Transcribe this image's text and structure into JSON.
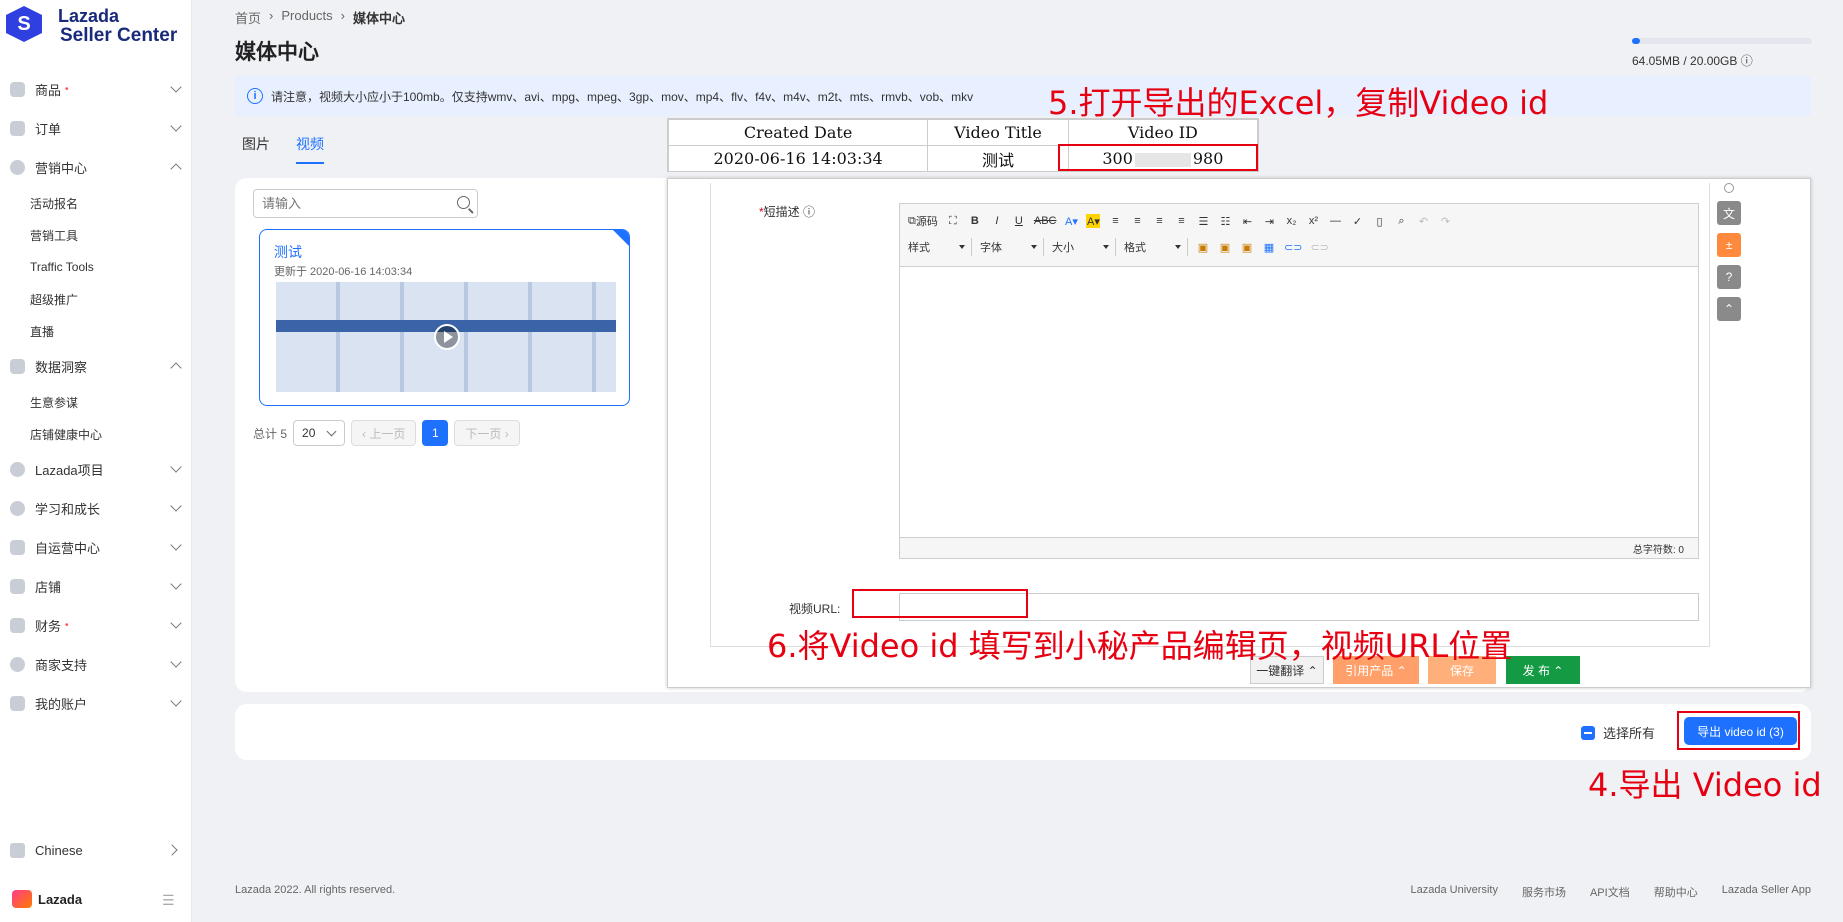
{
  "brand": {
    "line1": "Lazada",
    "line2": "Seller Center",
    "mark": "S"
  },
  "sidebar": {
    "items": [
      {
        "label": "商品",
        "dot": "•"
      },
      {
        "label": "订单"
      },
      {
        "label": "营销中心",
        "sub": [
          "活动报名",
          "营销工具",
          "Traffic Tools",
          "超级推广",
          "直播"
        ]
      },
      {
        "label": "数据洞察",
        "sub": [
          "生意参谋",
          "店铺健康中心"
        ]
      },
      {
        "label": "Lazada项目"
      },
      {
        "label": "学习和成长"
      },
      {
        "label": "自运营中心"
      },
      {
        "label": "店铺"
      },
      {
        "label": "财务",
        "dot": "•"
      },
      {
        "label": "商家支持"
      },
      {
        "label": "我的账户"
      }
    ],
    "language": "Chinese",
    "footer_logo": "Lazada"
  },
  "breadcrumb": [
    "首页",
    "Products",
    "媒体中心"
  ],
  "breadcrumb_sep": "›",
  "page_title": "媒体中心",
  "storage": {
    "text": "64.05MB / 20.00GB",
    "used_fraction": 0.003
  },
  "notice": "请注意，视频大小应小于100mb。仅支持wmv、avi、mpg、mpeg、3gp、mov、mp4、flv、f4v、m4v、m2t、mts、rmvb、vob、mkv",
  "tabs": [
    "图片",
    "视频"
  ],
  "search": {
    "placeholder": "请输入"
  },
  "video": {
    "title": "测试",
    "updated": "更新于 2020-06-16 14:03:34"
  },
  "pager": {
    "total": "总计 5",
    "size": "20",
    "prev": "‹ 上一页",
    "current": "1",
    "next": "下一页 ›"
  },
  "excel": {
    "headers": [
      "Created Date",
      "Video Title",
      "Video ID"
    ],
    "row": [
      "2020-06-16 14:03:34",
      "测试",
      "300",
      "980"
    ]
  },
  "editor": {
    "desc_label": "短描述",
    "required_mark": "*",
    "toolbar": {
      "source": "源码",
      "style": "样式",
      "font": "字体",
      "size": "大小",
      "format": "格式"
    },
    "char_count": "总字符数: 0",
    "url_label": "视频URL:",
    "buttons": {
      "translate": "一键翻译 ⌃",
      "quote": "引用产品 ⌃",
      "save": "保存",
      "publish": "发 布 ⌃"
    }
  },
  "bottom": {
    "select_all": "选择所有",
    "export": "导出 video id (3)"
  },
  "annotations": {
    "step5": "5.打开导出的Excel，复制Video id",
    "step6": "6.将Video id 填写到小秘产品编辑页，视频URL位置",
    "step4": "4.导出 Video id"
  },
  "footer": {
    "copyright": "Lazada 2022. All rights reserved.",
    "links": [
      "Lazada University",
      "服务市场",
      "API文档",
      "帮助中心",
      "Lazada Seller App"
    ]
  },
  "colors": {
    "accent": "#1e71ff",
    "annotation": "#e60012",
    "publish": "#139a43"
  }
}
